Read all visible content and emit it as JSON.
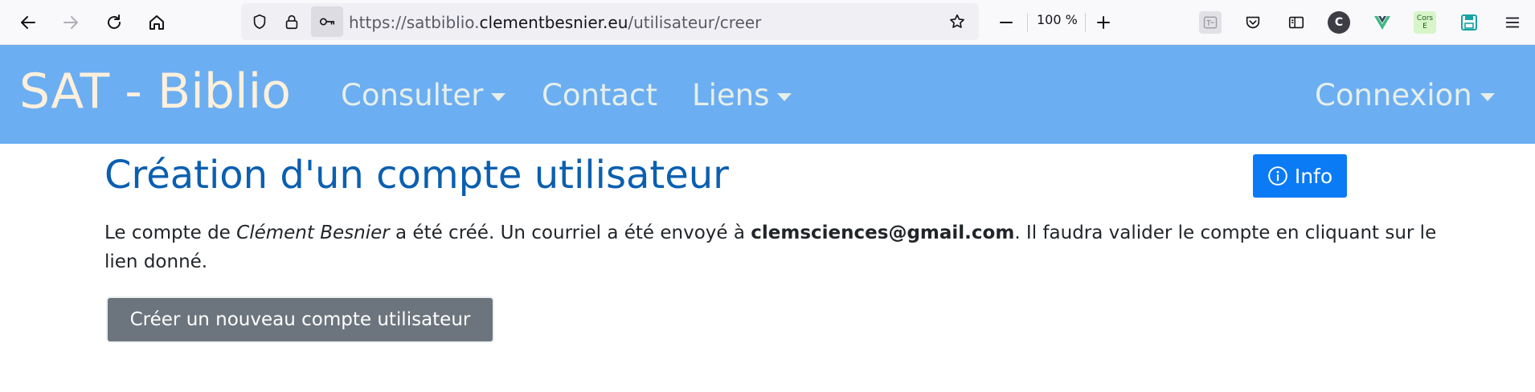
{
  "browser": {
    "url_scheme": "https://",
    "url_subdomain": "satbiblio.",
    "url_domain": "clementbesnier.eu",
    "url_path": "/utilisateur/creer",
    "zoom": "100 %",
    "extensions": {
      "avatar_letter": "C",
      "cors_line1": "Cors",
      "cors_line2": "E"
    },
    "colors": {
      "toolbar_bg": "#f9f9fb",
      "url_bg": "#f0f0f4",
      "vue_green": "#41b883",
      "save_teal": "#1aa3a3"
    }
  },
  "navbar": {
    "brand": "SAT - Biblio",
    "items": [
      {
        "label": "Consulter",
        "dropdown": true
      },
      {
        "label": "Contact",
        "dropdown": false
      },
      {
        "label": "Liens",
        "dropdown": true
      }
    ],
    "right_item": {
      "label": "Connexion",
      "dropdown": true
    },
    "colors": {
      "bg": "#6caef2",
      "brand": "#fdf0dc",
      "link": "#e6efe9"
    }
  },
  "main": {
    "title": "Création d'un compte utilisateur",
    "info_button": "Info",
    "message": {
      "part1": "Le compte de ",
      "name": "Clément Besnier",
      "part2": " a été créé. Un courriel a été envoyé à ",
      "email": "clemsciences@gmail.com",
      "part3": ". Il faudra valider le compte en cliquant sur le lien donné."
    },
    "new_account_button": "Créer un nouveau compte utilisateur",
    "colors": {
      "title": "#0b5fb0",
      "info_btn": "#0b7bf5",
      "secondary_btn": "#6c757d"
    }
  }
}
